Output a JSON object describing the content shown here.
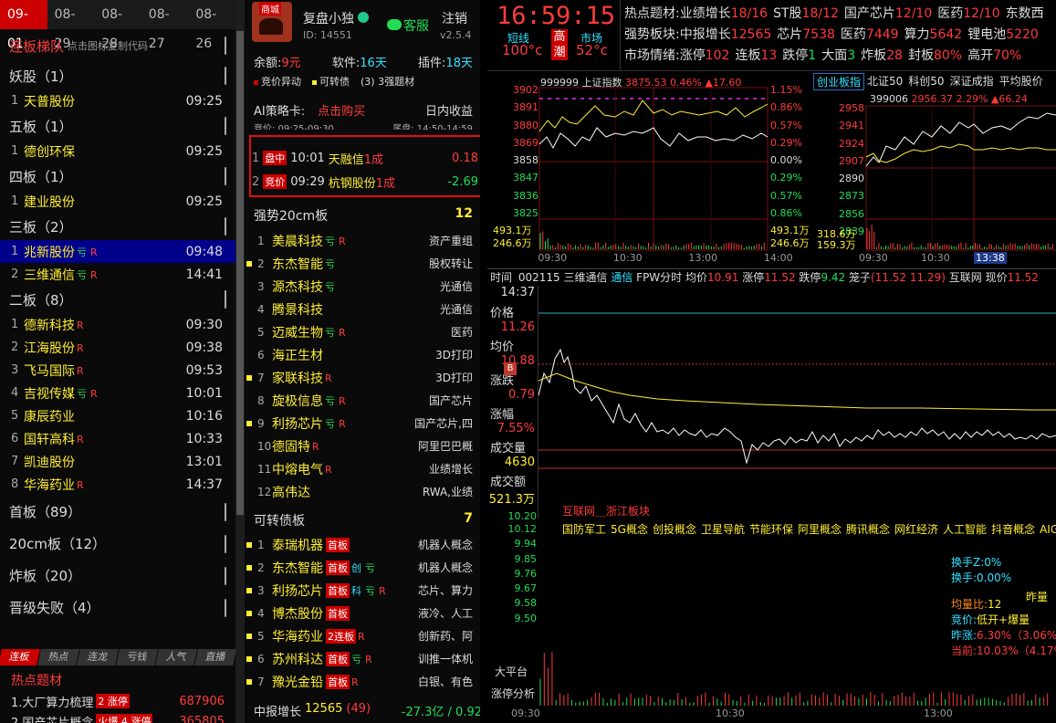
{
  "dates": [
    "09-01",
    "08-29",
    "08-28",
    "08-27",
    "08-26"
  ],
  "left": {
    "title": "连板梯队",
    "hint": "点击图标复制代码",
    "sections": [
      {
        "label": "妖股（1）",
        "items": [
          {
            "n": "1",
            "name": "天普股份",
            "tags": "",
            "time": "09:25"
          }
        ]
      },
      {
        "label": "五板（1）",
        "items": [
          {
            "n": "1",
            "name": "德创环保",
            "tags": "",
            "time": "09:25"
          }
        ]
      },
      {
        "label": "四板（1）",
        "items": [
          {
            "n": "1",
            "name": "建业股份",
            "tags": "",
            "time": "09:25"
          }
        ]
      },
      {
        "label": "三板（2）",
        "items": [
          {
            "n": "1",
            "name": "兆新股份",
            "tags": "亏R",
            "time": "09:48",
            "sel": true
          },
          {
            "n": "2",
            "name": "三维通信",
            "tags": "亏R",
            "time": "14:41"
          }
        ]
      },
      {
        "label": "二板（8）",
        "items": [
          {
            "n": "1",
            "name": "德新科技",
            "tags": "R",
            "time": "09:30"
          },
          {
            "n": "2",
            "name": "江海股份",
            "tags": "R",
            "time": "09:38"
          },
          {
            "n": "3",
            "name": "飞马国际",
            "tags": "R",
            "time": "09:53"
          },
          {
            "n": "4",
            "name": "吉视传媒",
            "tags": "亏R",
            "time": "10:01"
          },
          {
            "n": "5",
            "name": "康辰药业",
            "tags": "",
            "time": "10:16"
          },
          {
            "n": "6",
            "name": "国轩高科",
            "tags": "R",
            "time": "10:33"
          },
          {
            "n": "7",
            "name": "凯迪股份",
            "tags": "",
            "time": "13:01"
          },
          {
            "n": "8",
            "name": "华海药业",
            "tags": "R",
            "time": "14:37"
          }
        ]
      }
    ],
    "folded": [
      "首板（89）",
      "20cm板（12）",
      "炸板（20）",
      "晋级失败（4）"
    ],
    "tabs": [
      "连板",
      "热点",
      "连龙",
      "亏钱",
      "人气",
      "直播"
    ],
    "hot_title": "热点题材",
    "hot": [
      {
        "name": "1.大厂算力梳理",
        "badge": "2 涨停",
        "val": "687906"
      },
      {
        "name": "2.国产芯片概念",
        "badge": "火爆  4 涨停",
        "val": "365805"
      }
    ]
  },
  "mid": {
    "tag": "商城",
    "user": "复盘小独",
    "id": "ID: 14551",
    "service": "客服",
    "logout": "注销",
    "version": "v2.5.4",
    "balance_label": "余额:",
    "balance": "9元",
    "soft_label": "软件:",
    "soft": "16天",
    "plugin_label": "插件:",
    "plugin": "18天",
    "legend": [
      "竞价异动",
      "可转债",
      "(3)  3强题材"
    ],
    "card_label": "AI策略卡:",
    "card_buy": "点击购买",
    "card_right": "日内收益",
    "bid_time": "竞价:  09:25-09:30",
    "end_time": "尾盘:  14:50-14:59",
    "strategy": [
      {
        "n": "1",
        "badge": "盘中",
        "time": "10:01",
        "name": "天融信",
        "suffix": "1成",
        "val": "0.18"
      },
      {
        "n": "2",
        "badge": "竞价",
        "time": "09:29",
        "name": "杭钢股份",
        "suffix": "1成",
        "val": "-2.69"
      }
    ],
    "strong_title": "强势20cm板",
    "strong_count": "12",
    "strong": [
      {
        "n": "1",
        "name": "美晨科技",
        "tags": "亏R",
        "right": "资产重组",
        "mark": false
      },
      {
        "n": "2",
        "name": "东杰智能",
        "tags": "亏",
        "right": "股权转让",
        "mark": true
      },
      {
        "n": "3",
        "name": "源杰科技",
        "tags": "亏",
        "right": "光通信",
        "mark": false
      },
      {
        "n": "4",
        "name": "腾景科技",
        "tags": "",
        "right": "光通信",
        "mark": false
      },
      {
        "n": "5",
        "name": "迈威生物",
        "tags": "亏R",
        "right": "医药",
        "mark": false
      },
      {
        "n": "6",
        "name": "海正生材",
        "tags": "",
        "right": "3D打印",
        "mark": false
      },
      {
        "n": "7",
        "name": "家联科技",
        "tags": "R",
        "right": "3D打印",
        "mark": true
      },
      {
        "n": "8",
        "name": "旋极信息",
        "tags": "亏R",
        "right": "国产芯片",
        "mark": false
      },
      {
        "n": "9",
        "name": "利扬芯片",
        "tags": "亏R",
        "right": "国产芯片,四",
        "mark": true
      },
      {
        "n": "10",
        "name": "德固特",
        "tags": "R",
        "right": "阿里巴巴概",
        "mark": false
      },
      {
        "n": "11",
        "name": "中熔电气",
        "tags": "R",
        "right": "业绩增长",
        "mark": false
      },
      {
        "n": "12",
        "name": "高伟达",
        "tags": "",
        "right": "RWA,业绩",
        "mark": false
      }
    ],
    "bond_title": "可转债板",
    "bond_count": "7",
    "bonds": [
      {
        "n": "1",
        "name": "泰瑞机器",
        "badge": "首板",
        "tags": "",
        "right": "机器人概念"
      },
      {
        "n": "2",
        "name": "东杰智能",
        "badge": "首板",
        "tags": "创亏",
        "right": "机器人概念"
      },
      {
        "n": "3",
        "name": "利扬芯片",
        "badge": "首板",
        "tags": "科亏R",
        "right": "芯片、算力"
      },
      {
        "n": "4",
        "name": "博杰股份",
        "badge": "首板",
        "tags": "",
        "right": "液冷、人工"
      },
      {
        "n": "5",
        "name": "华海药业",
        "badge": "2连板",
        "tags": "R",
        "right": "创新药、阿"
      },
      {
        "n": "6",
        "name": "苏州科达",
        "badge": "首板",
        "tags": "亏R",
        "right": "训推一体机"
      },
      {
        "n": "7",
        "name": "豫光金铅",
        "badge": "首板",
        "tags": "R",
        "right": "白银、有色"
      }
    ],
    "footer_name": "中报增长",
    "footer_num": "12565",
    "footer_cnt": "(49)",
    "footer_val": "-27.3亿 / 0.92"
  },
  "top": {
    "time": "16:59:15",
    "short_label": "短线",
    "short_val": "100°c",
    "gao": "高",
    "chao": "潮",
    "mkt_label": "市场",
    "mkt_val": "52°c",
    "row1": [
      [
        "热点题材:",
        ""
      ],
      [
        "业绩增长",
        "18/16"
      ],
      [
        "ST股",
        "18/12"
      ],
      [
        "国产芯片",
        "12/10"
      ],
      [
        "医药",
        "12/10"
      ],
      [
        "东数西",
        ""
      ]
    ],
    "row2": [
      [
        "强势板块:",
        ""
      ],
      [
        "中报增长",
        "12565"
      ],
      [
        "芯片",
        "7538"
      ],
      [
        "医药",
        "7449"
      ],
      [
        "算力",
        "5642"
      ],
      [
        "锂电池",
        "5220"
      ]
    ],
    "row3": [
      [
        "市场情绪:",
        ""
      ],
      [
        "涨停",
        "102"
      ],
      [
        "连板",
        "13"
      ],
      [
        "跌停",
        "1"
      ],
      [
        "大面",
        "3"
      ],
      [
        "炸板",
        "28"
      ],
      [
        "封板",
        "80%"
      ],
      [
        "高开",
        "70%"
      ]
    ]
  },
  "idx1": {
    "code": "999999",
    "name": "上证指数",
    "price": "3875.53",
    "pct": "0.46%",
    "chg": "▲17.60",
    "left_ticks": [
      "3902",
      "3891",
      "3880",
      "3869",
      "3858",
      "3847",
      "3836",
      "3825"
    ],
    "right_ticks": [
      "1.15%",
      "0.86%",
      "0.57%",
      "0.29%",
      "0.00%",
      "0.29%",
      "0.57%",
      "0.86%"
    ],
    "vol1": "493.1万",
    "vol2": "246.6万",
    "x_ticks": [
      "09:30",
      "10:30",
      "13:00",
      "14:00"
    ]
  },
  "idx2": {
    "tabs": [
      "创业板指",
      "北证50",
      "科创50",
      "深证成指",
      "平均股价"
    ],
    "code": "399006",
    "price": "2956.37",
    "pct": "2.29%",
    "chg": "▲66.24",
    "left_ticks": [
      "2958",
      "2941",
      "2924",
      "2907",
      "2890",
      "2873",
      "2856",
      "2839"
    ],
    "vol1": "318.6万",
    "vol2": "159.3万",
    "x_ticks": [
      "09:30",
      "10:30",
      "13:38"
    ]
  },
  "detail": {
    "header": [
      "时间",
      "002115",
      "三维通信",
      "通信",
      "FPW分时",
      "均价",
      "10.91",
      "涨停",
      "11.52",
      "跌停",
      "9.42",
      "笼子",
      "(11.52  11.29)",
      "互联网",
      "现价",
      "11.52"
    ],
    "time": "14:37",
    "price_label": "价格",
    "price": "11.26",
    "avg_label": "均价",
    "avg": "10.88",
    "chg_label": "涨跌",
    "chg": "0.79",
    "amp_label": "涨幅",
    "amp": "7.55%",
    "vol_label": "成交量",
    "vol": "4630",
    "amt_label": "成交额",
    "amt": "521.3万",
    "sector": "互联网＿浙江板块",
    "concepts": [
      "国防军工",
      "5G概念",
      "创投概念",
      "卫星导航",
      "节能环保",
      "阿里概念",
      "腾讯概念",
      "网红经济",
      "人工智能",
      "抖音概念",
      "AIGC"
    ],
    "ladder": [
      "10.12",
      "9.94",
      "9.85",
      "9.76",
      "9.67",
      "9.58",
      "9.50"
    ],
    "ladder_top": "10.20",
    "info": [
      [
        "换手Z:",
        "0%"
      ],
      [
        "换手:",
        "0.00%"
      ],
      [
        "均量比:",
        "12"
      ],
      [
        "竞价:",
        "低开+爆量"
      ],
      [
        "昨涨:",
        "6.30%（3.06%"
      ],
      [
        "当前:",
        "10.03%（4.17%"
      ]
    ],
    "side_right": "昨量",
    "btns": [
      "大平台",
      "涨停分析"
    ],
    "x_ticks": [
      "09:30",
      "10:30",
      "13:00"
    ],
    "b_mark": "B"
  }
}
